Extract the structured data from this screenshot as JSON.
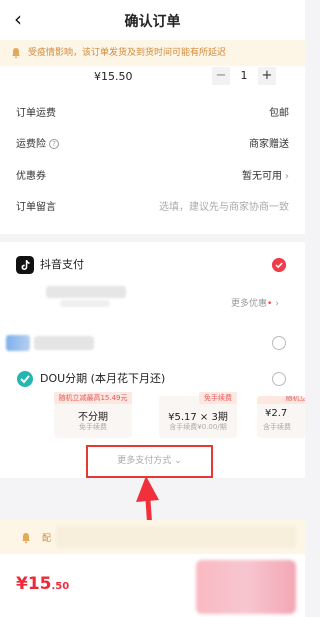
{
  "nav": {
    "back_icon": "chevron-left-icon",
    "title": "确认订单"
  },
  "notice": {
    "text": "受疫情影响，该订单发货及到货时间可能有所延迟",
    "icon": "bell-icon",
    "color": "#d08a3c"
  },
  "product": {
    "price": "¥15.50",
    "quantity": "1",
    "minus": "−",
    "plus": "+"
  },
  "order_rows": [
    {
      "label": "订单运费",
      "value": "包邮"
    },
    {
      "label": "运费险",
      "value": "商家赠送"
    },
    {
      "label": "优惠券",
      "value": "暂无可用"
    },
    {
      "label": "订单留言",
      "placeholder": "选填，建议先与商家协商一致"
    }
  ],
  "payment": {
    "douyin_pay": {
      "label": "抖音支付",
      "selected": true
    },
    "more_offers": "更多优惠",
    "dou_installment": {
      "label": "DOU分期 (本月花下月还)",
      "plans": [
        {
          "tag": "随机立减最高15.49元",
          "main": "不分期",
          "sub": "免手续费"
        },
        {
          "tag": "免手续费",
          "main": "¥5.17 × 3期",
          "sub": "含手续费¥0.00/期"
        },
        {
          "tag": "随机立",
          "main": "¥2.7",
          "sub": "含手续费"
        }
      ]
    },
    "more_methods": "更多支付方式"
  },
  "bottom": {
    "notice_text": "配",
    "total_big": "¥15",
    "total_small": ".50"
  },
  "colors": {
    "accent": "#ee2a3a",
    "highlight_box": "#e53935",
    "notice_bg": "#fdf6e6"
  }
}
